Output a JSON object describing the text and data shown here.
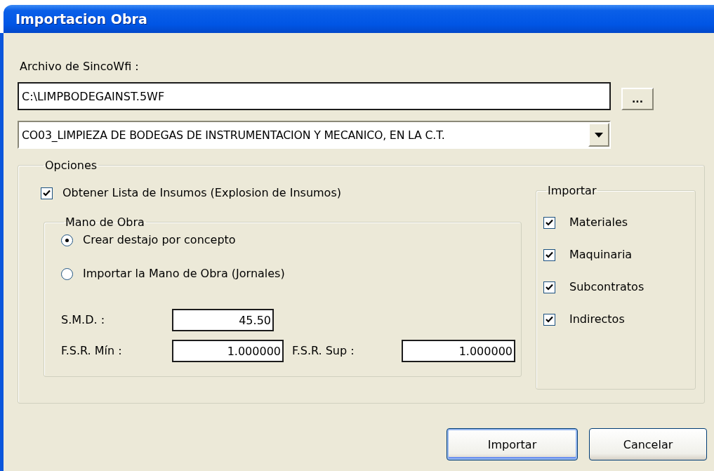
{
  "window": {
    "title": "Importacion Obra"
  },
  "file": {
    "label": "Archivo de SincoWfi :",
    "value": "C:\\LIMPBODEGAINST.5WF",
    "browse_button": "..."
  },
  "project": {
    "value": "CO03_LIMPIEZA DE BODEGAS DE INSTRUMENTACION Y MECANICO, EN LA C.T."
  },
  "options": {
    "title": "Opciones",
    "explode": {
      "label": "Obtener Lista de Insumos (Explosion de Insumos)",
      "checked": true
    },
    "labor": {
      "title": "Mano de Obra",
      "modes": [
        {
          "label": "Crear destajo por concepto",
          "selected": true
        },
        {
          "label": "Importar la Mano de Obra (Jornales)",
          "selected": false
        }
      ],
      "rows": [
        [
          {
            "label": "S.M.D. :",
            "value": "45.50"
          }
        ],
        [
          {
            "label": "F.S.R. Mín :",
            "value": "1.000000"
          },
          {
            "label": "F.S.R. Sup :",
            "value": "1.000000"
          }
        ]
      ]
    },
    "import": {
      "title": "Importar",
      "items": [
        {
          "label": "Materiales",
          "checked": true
        },
        {
          "label": "Maquinaria",
          "checked": true
        },
        {
          "label": "Subcontratos",
          "checked": true
        },
        {
          "label": "Indirectos",
          "checked": true
        }
      ]
    }
  },
  "buttons": [
    {
      "label": "Importar",
      "default": true
    },
    {
      "label": "Cancelar",
      "default": false
    }
  ]
}
